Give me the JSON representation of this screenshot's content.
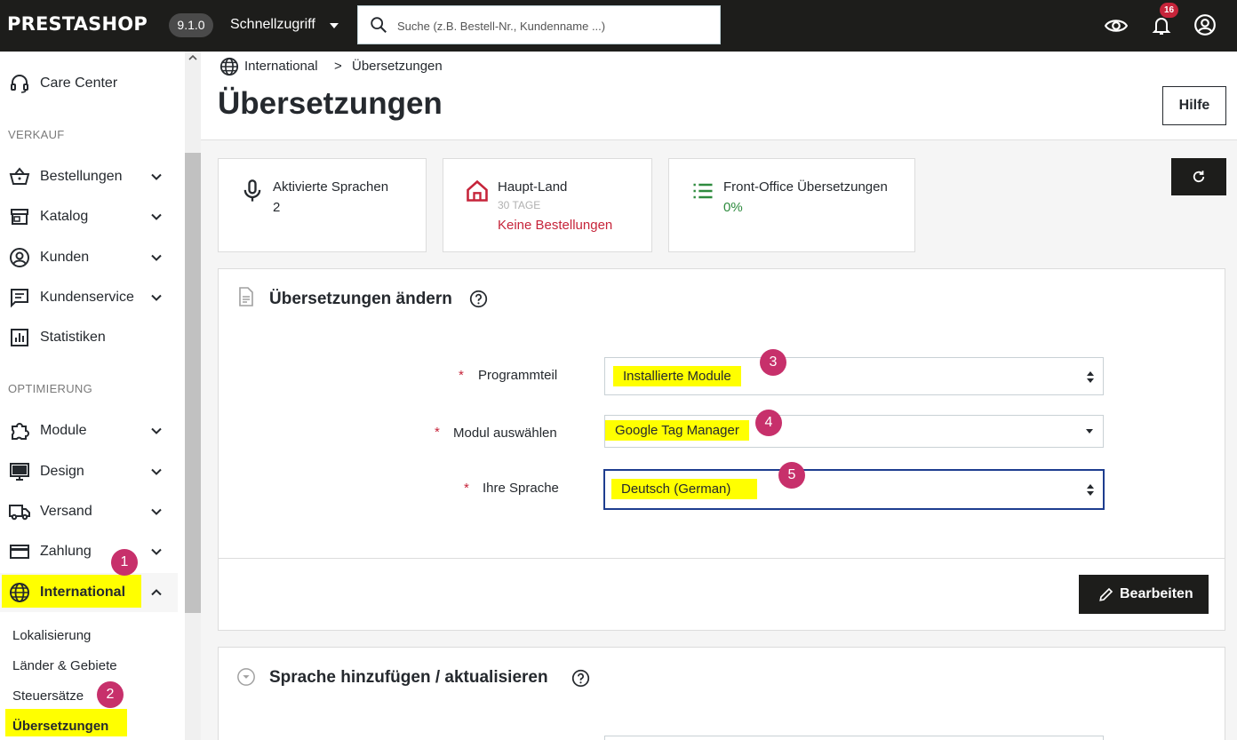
{
  "topbar": {
    "logo": "PRESTASHOP",
    "version": "9.1.0",
    "quick_access": "Schnellzugriff",
    "search_placeholder": "Suche (z.B. Bestell-Nr., Kundenname ...)",
    "notification_count": "16"
  },
  "sidebar": {
    "care_center": "Care Center",
    "section_sales": "VERKAUF",
    "sales_items": [
      "Bestellungen",
      "Katalog",
      "Kunden",
      "Kundenservice",
      "Statistiken"
    ],
    "section_optimization": "OPTIMIERUNG",
    "opt_items": [
      "Module",
      "Design",
      "Versand",
      "Zahlung",
      "International"
    ],
    "international_submenu": [
      "Lokalisierung",
      "Länder & Gebiete",
      "Steuersätze",
      "Übersetzungen"
    ]
  },
  "breadcrumb": {
    "parent": "International",
    "separator": ">",
    "current": "Übersetzungen"
  },
  "page_title": "Übersetzungen",
  "help_label": "Hilfe",
  "kpis": [
    {
      "title": "Aktivierte Sprachen",
      "value": "2"
    },
    {
      "title": "Haupt-Land",
      "sub": "30 TAGE",
      "value": "Keine Bestellungen"
    },
    {
      "title": "Front-Office Übersetzungen",
      "value": "0%"
    }
  ],
  "modify_card": {
    "title": "Übersetzungen ändern",
    "fields": [
      {
        "label": "Programmteil",
        "value": "Installierte Module"
      },
      {
        "label": "Modul auswählen",
        "value": "Google Tag Manager"
      },
      {
        "label": "Ihre Sprache",
        "value": "Deutsch (German)"
      }
    ],
    "required_mark": "*",
    "edit_label": "Bearbeiten"
  },
  "add_card": {
    "title": "Sprache hinzufügen / aktualisieren"
  },
  "markers": [
    "1",
    "2",
    "3",
    "4",
    "5"
  ],
  "colors": {
    "topbar": "#1d1d1b",
    "highlight": "#ffff00",
    "marker": "#c7306b",
    "danger": "#c6243a",
    "success": "#2e8b3e",
    "focus_border": "#1e3d8f"
  }
}
